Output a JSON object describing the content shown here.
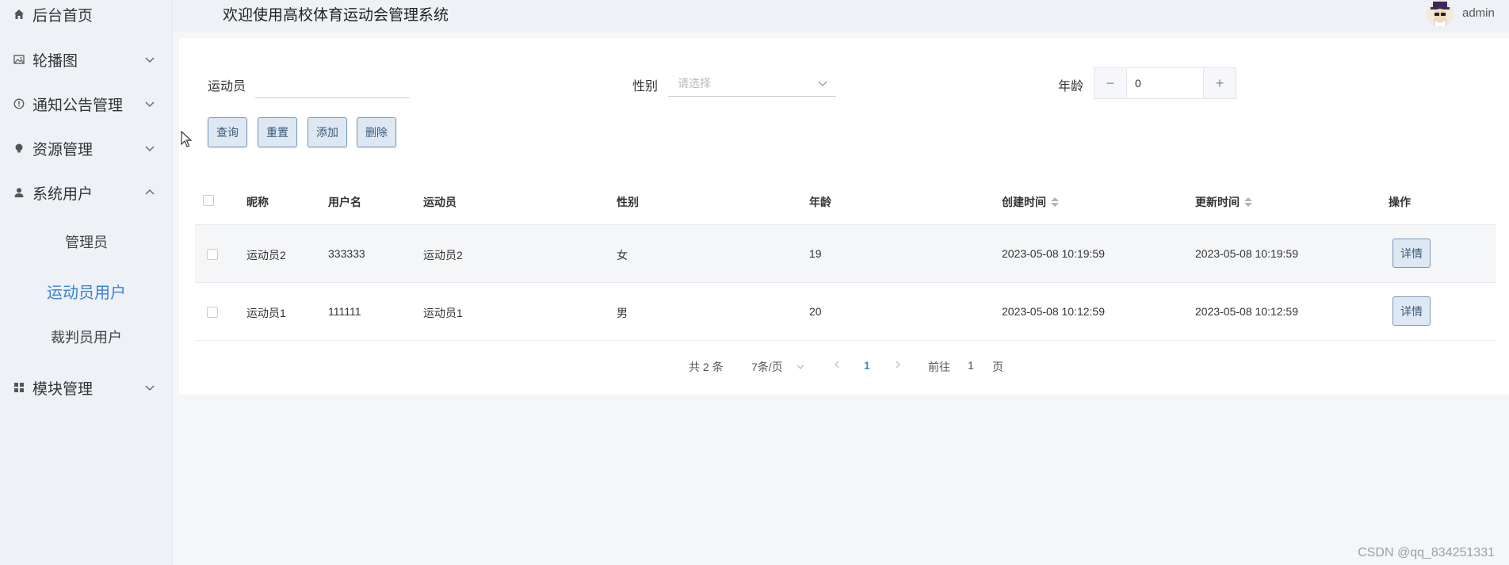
{
  "sidebar": {
    "items": [
      {
        "label": "后台首页",
        "icon": "home-icon",
        "expanded": null
      },
      {
        "label": "轮播图",
        "icon": "image-icon",
        "expanded": false
      },
      {
        "label": "通知公告管理",
        "icon": "info-icon",
        "expanded": false
      },
      {
        "label": "资源管理",
        "icon": "bulb-icon",
        "expanded": false
      },
      {
        "label": "系统用户",
        "icon": "user-icon",
        "expanded": true
      },
      {
        "label": "模块管理",
        "icon": "grid-icon",
        "expanded": false
      }
    ],
    "sub_items": [
      {
        "label": "管理员",
        "active": false
      },
      {
        "label": "运动员用户",
        "active": true
      },
      {
        "label": "裁判员用户",
        "active": false
      }
    ]
  },
  "header": {
    "title": "欢迎使用高校体育运动会管理系统",
    "username": "admin"
  },
  "search": {
    "athlete_label": "运动员",
    "athlete_value": "",
    "gender_label": "性别",
    "gender_placeholder": "请选择",
    "age_label": "年龄",
    "age_value": "0",
    "minus": "−",
    "plus": "+"
  },
  "toolbar": {
    "query": "查询",
    "reset": "重置",
    "add": "添加",
    "delete": "删除"
  },
  "table": {
    "headers": {
      "nickname": "昵称",
      "username": "用户名",
      "athlete": "运动员",
      "gender": "性别",
      "age": "年龄",
      "created": "创建时间",
      "updated": "更新时间",
      "actions": "操作"
    },
    "rows": [
      {
        "nickname": "运动员2",
        "username": "333333",
        "athlete": "运动员2",
        "gender": "女",
        "age": "19",
        "created": "2023-05-08 10:19:59",
        "updated": "2023-05-08 10:19:59",
        "action": "详情"
      },
      {
        "nickname": "运动员1",
        "username": "111111",
        "athlete": "运动员1",
        "gender": "男",
        "age": "20",
        "created": "2023-05-08 10:12:59",
        "updated": "2023-05-08 10:12:59",
        "action": "详情"
      }
    ]
  },
  "pagination": {
    "total": "共 2 条",
    "page_size": "7条/页",
    "current": "1",
    "goto_prefix": "前往",
    "goto_value": "1",
    "goto_suffix": "页"
  },
  "watermark": "CSDN @qq_834251331",
  "colors": {
    "accent": "#3a7fd8",
    "sidebar_bg": "#eef1f5",
    "button_bg": "#dde8f3",
    "button_border": "#7a98b8"
  }
}
